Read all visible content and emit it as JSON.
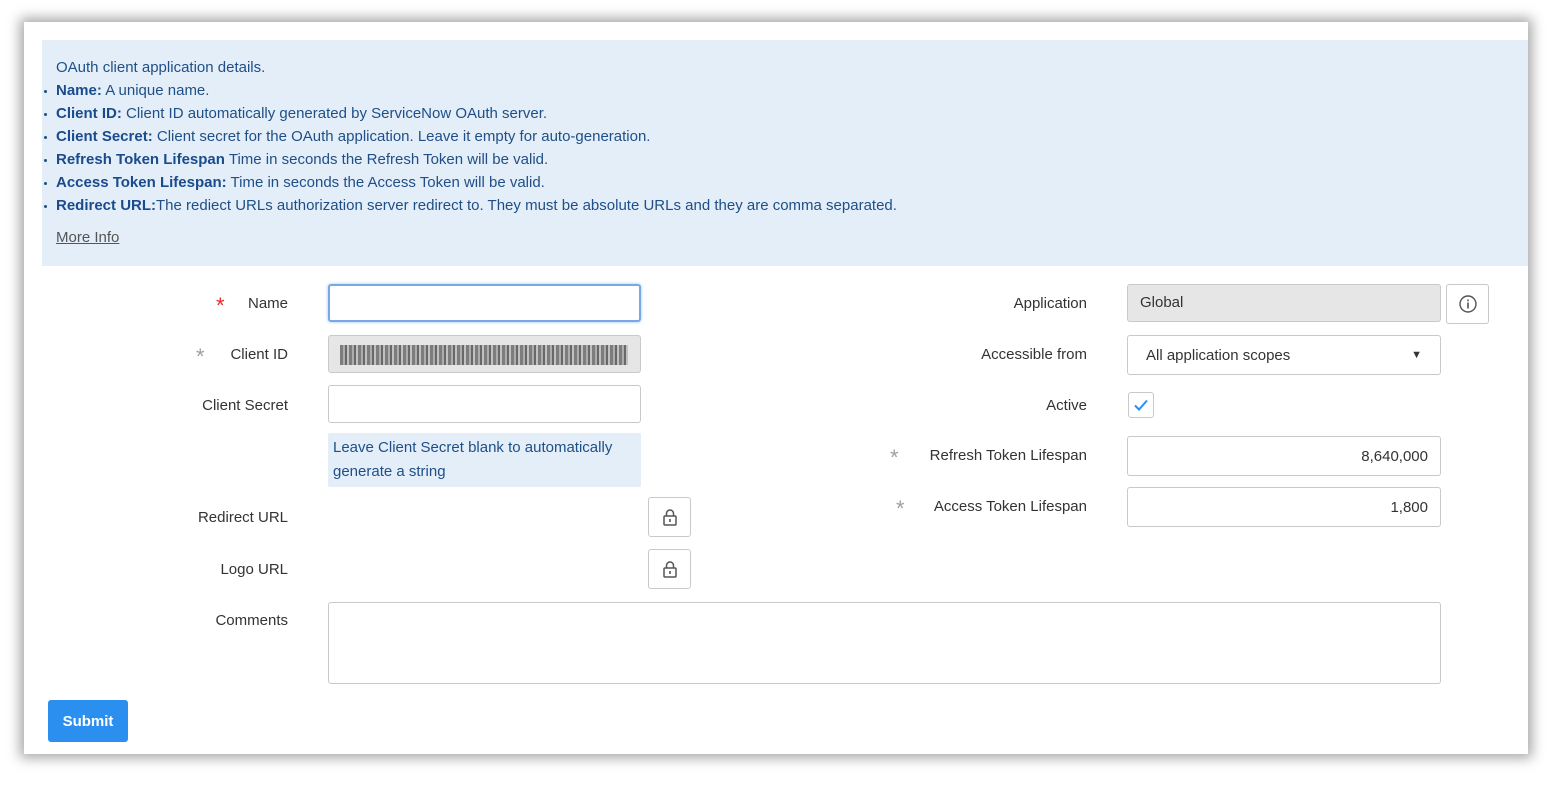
{
  "info": {
    "intro": "OAuth client application details.",
    "items": [
      {
        "term": "Name:",
        "desc": " A unique name."
      },
      {
        "term": "Client ID:",
        "desc": " Client ID automatically generated by ServiceNow OAuth server."
      },
      {
        "term": "Client Secret:",
        "desc": " Client secret for the OAuth application. Leave it empty for auto-generation."
      },
      {
        "term": "Refresh Token Lifespan",
        "desc": " Time in seconds the Refresh Token will be valid."
      },
      {
        "term": "Access Token Lifespan:",
        "desc": " Time in seconds the Access Token will be valid."
      },
      {
        "term": "Redirect URL:",
        "desc": "The rediect URLs authorization server redirect to. They must be absolute URLs and they are comma separated."
      }
    ],
    "more_info": "More Info"
  },
  "form": {
    "name_label": "Name",
    "name_value": "",
    "client_id_label": "Client ID",
    "client_secret_label": "Client Secret",
    "client_secret_value": "",
    "client_secret_hint": "Leave Client Secret blank to automatically generate a string",
    "redirect_url_label": "Redirect URL",
    "logo_url_label": "Logo URL",
    "comments_label": "Comments",
    "comments_value": "",
    "application_label": "Application",
    "application_value": "Global",
    "accessible_from_label": "Accessible from",
    "accessible_from_value": "All application scopes",
    "active_label": "Active",
    "active_checked": true,
    "refresh_label": "Refresh Token Lifespan",
    "refresh_value": "8,640,000",
    "access_label": "Access Token Lifespan",
    "access_value": "1,800",
    "submit_label": "Submit",
    "required_symbol": "*"
  },
  "icons": {
    "lock": "lock-icon",
    "info": "info-icon",
    "check": "check-icon",
    "dropdown": "caret-down-icon"
  },
  "colors": {
    "info_bg": "#e3eef9",
    "info_text": "#1f4f86",
    "required_mandatory": "#e42a2a",
    "required_filled": "#a0a0a0",
    "submit": "#2b8ff0",
    "check": "#2b8ff0"
  }
}
